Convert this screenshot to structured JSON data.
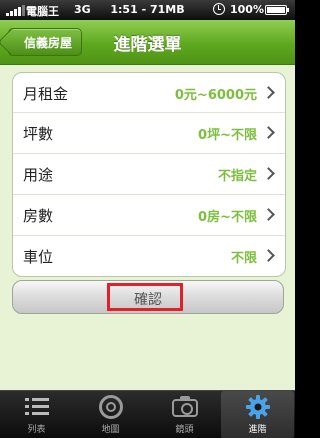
{
  "status_bar": {
    "carrier": "電腦王",
    "network": "3G",
    "time_text": "1:51 - 71MB",
    "battery_text": "100%"
  },
  "nav": {
    "back_label": "信義房屋",
    "title": "進階選單"
  },
  "options": [
    {
      "label": "月租金",
      "value": "0元~6000元"
    },
    {
      "label": "坪數",
      "value": "0坪~不限"
    },
    {
      "label": "用途",
      "value": "不指定"
    },
    {
      "label": "房數",
      "value": "0房~不限"
    },
    {
      "label": "車位",
      "value": "不限"
    }
  ],
  "confirm_label": "確認",
  "tabs": [
    {
      "label": "列表",
      "icon": "list-icon"
    },
    {
      "label": "地圖",
      "icon": "map-icon"
    },
    {
      "label": "鏡頭",
      "icon": "camera-icon"
    },
    {
      "label": "進階",
      "icon": "gear-icon",
      "selected": true
    }
  ],
  "colors": {
    "nav_green": "#5ea820",
    "value_green": "#7cbf3c",
    "highlight_red": "#e0202b",
    "background": "#e8f3d6"
  }
}
